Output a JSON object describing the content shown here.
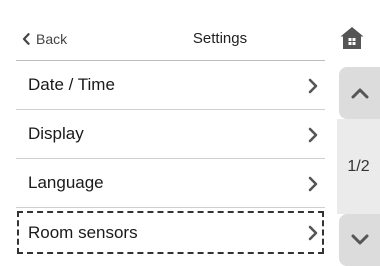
{
  "header": {
    "back_label": "Back",
    "title": "Settings"
  },
  "menu": {
    "items": [
      {
        "label": "Date / Time"
      },
      {
        "label": "Display"
      },
      {
        "label": "Language"
      },
      {
        "label": "Room sensors"
      }
    ],
    "focused_item": "Room sensors"
  },
  "pager": {
    "indicator": "1/2"
  },
  "icons": {
    "back": "chevron-left-icon",
    "home": "home-icon",
    "row": "chevron-right-icon",
    "up": "chevron-up-icon",
    "down": "chevron-down-icon"
  },
  "colors": {
    "pager_button": "#dcdcdc",
    "pager_track": "#ebebeb",
    "icon": "#555555",
    "separator": "#cfcfcf"
  }
}
